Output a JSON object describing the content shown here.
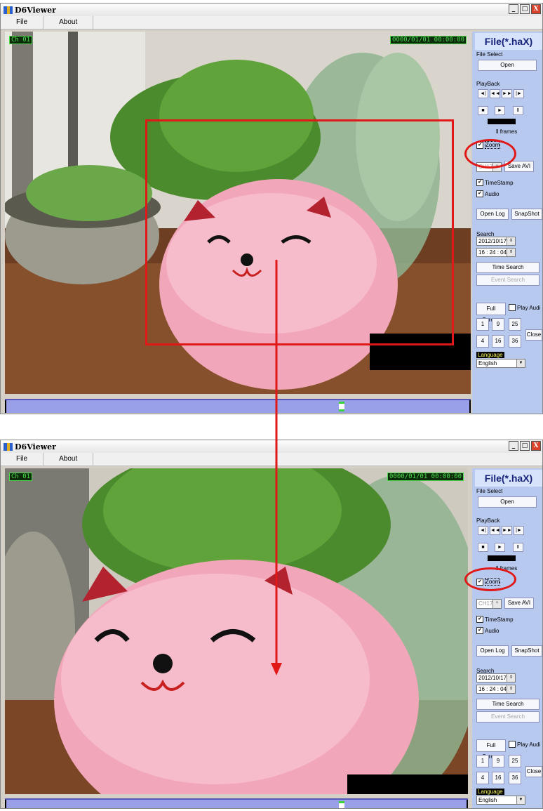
{
  "app": {
    "title": "D6Viewer",
    "win_buttons": [
      "_",
      "□",
      "X"
    ]
  },
  "menu": [
    "File",
    "About"
  ],
  "video": {
    "channel": "Ch 01",
    "timestamp": "0000/01/01 00:00:00"
  },
  "side": {
    "file_title": "File(*.haX)",
    "file_select_label": "File Select",
    "open_label": "Open",
    "playback_label": "PlayBack",
    "transport_row1": [
      "◄|",
      "◄◄",
      "►►",
      "|►"
    ],
    "transport_row2": [
      "■",
      "►",
      "II"
    ],
    "display_all_frames": "Display all frames",
    "display_all_frames_visible": "ll frames",
    "zoom_label": "Zoom",
    "channel_select": "CH17",
    "save_avi": "Save AVI",
    "timestamp_label": "TimeStamp",
    "audio_label": "Audio",
    "open_log": "Open Log",
    "snapshot": "SnapShot",
    "search_label": "Search",
    "date": "2012/10/17",
    "time": "16 : 24 : 04",
    "time_search": "Time Search",
    "event_search": "Event Search",
    "full_screen": "Full Screen",
    "play_audio": "Play Audi",
    "num_buttons": [
      "1",
      "9",
      "25",
      "4",
      "16",
      "36"
    ],
    "close": "Close",
    "language_label": "Language",
    "language_value": "English"
  },
  "annotation": {
    "highlight_color": "#e01818"
  }
}
